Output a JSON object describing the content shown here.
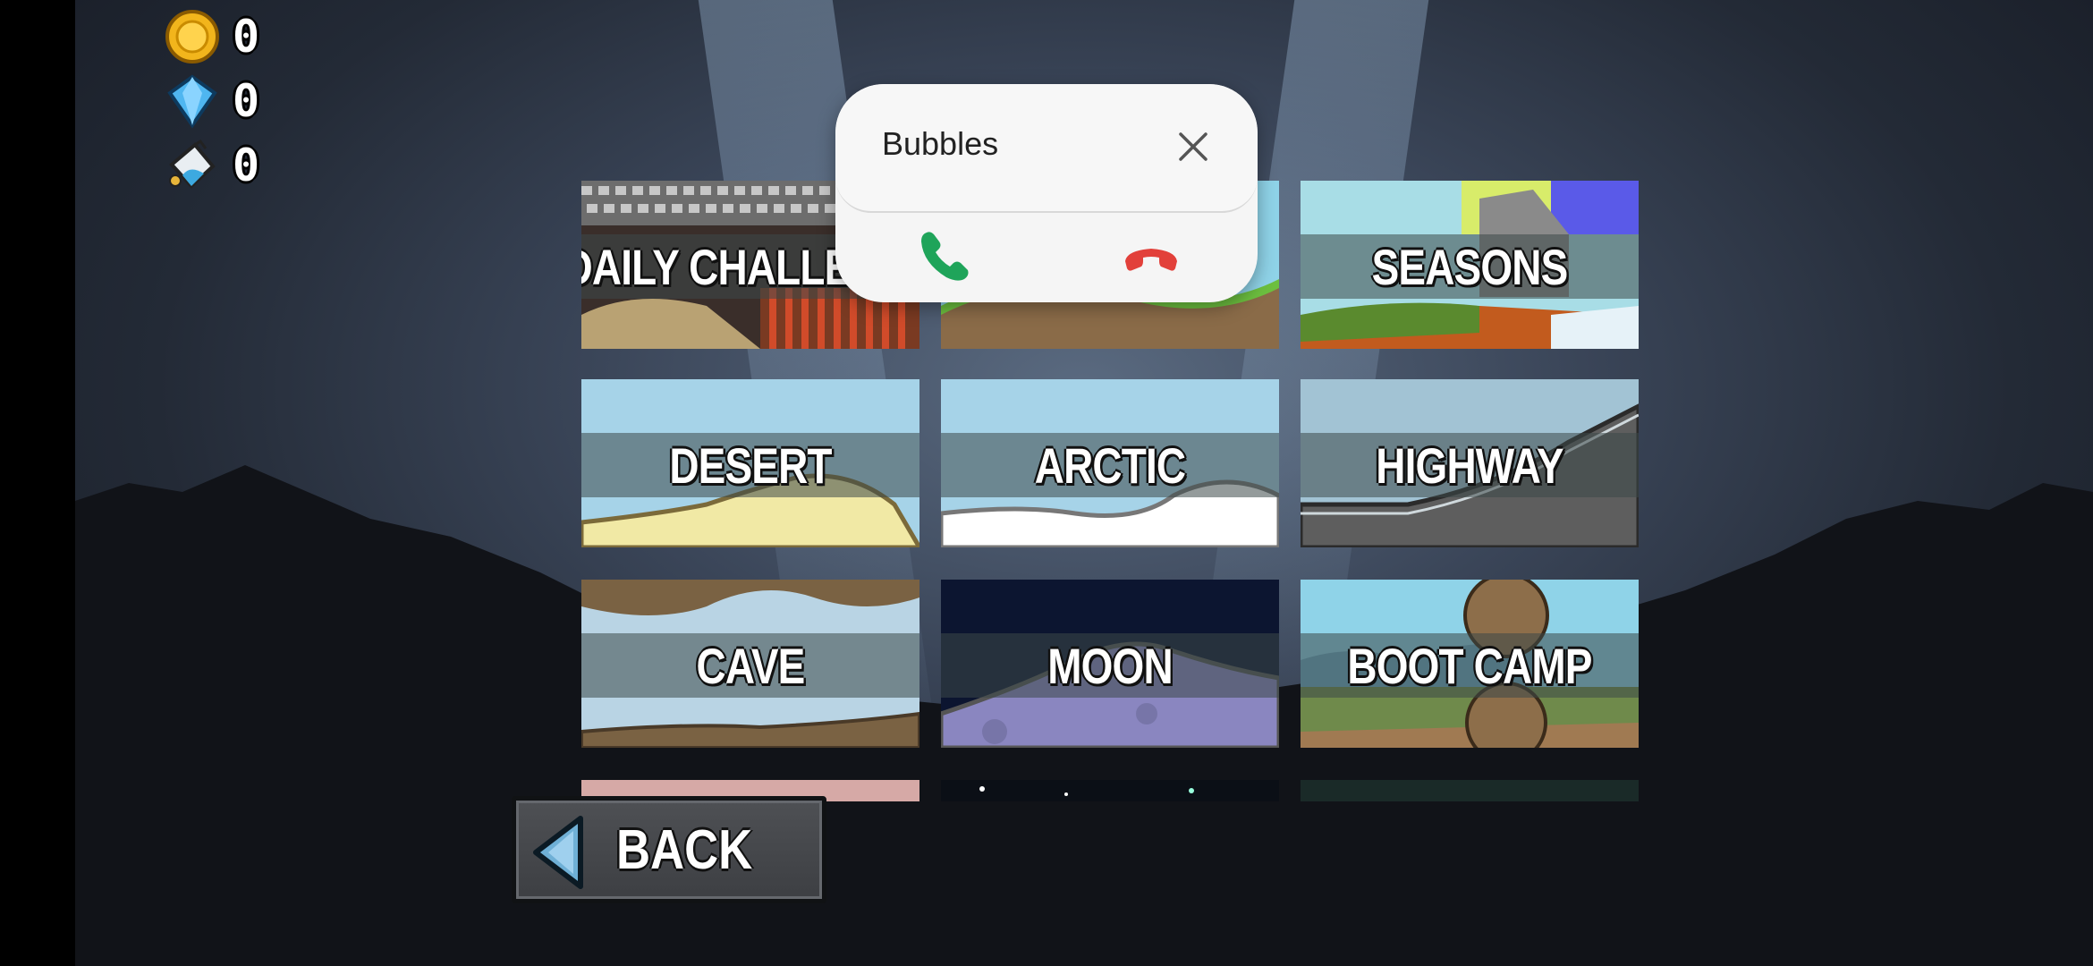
{
  "hud": {
    "coins": "0",
    "gems": "0",
    "paint": "0"
  },
  "levels": [
    {
      "label": "DAILY CHALLENGE",
      "theme": "daily"
    },
    {
      "label": "",
      "theme": "countryside"
    },
    {
      "label": "SEASONS",
      "theme": "seasons"
    },
    {
      "label": "DESERT",
      "theme": "desert"
    },
    {
      "label": "ARCTIC",
      "theme": "arctic"
    },
    {
      "label": "HIGHWAY",
      "theme": "highway"
    },
    {
      "label": "CAVE",
      "theme": "cave"
    },
    {
      "label": "MOON",
      "theme": "moon"
    },
    {
      "label": "BOOT CAMP",
      "theme": "bootcamp"
    }
  ],
  "back_button": {
    "label": "BACK"
  },
  "call_bubble": {
    "caller": "Bubbles",
    "accept_color": "#1fa45a",
    "decline_color": "#e2403a"
  }
}
